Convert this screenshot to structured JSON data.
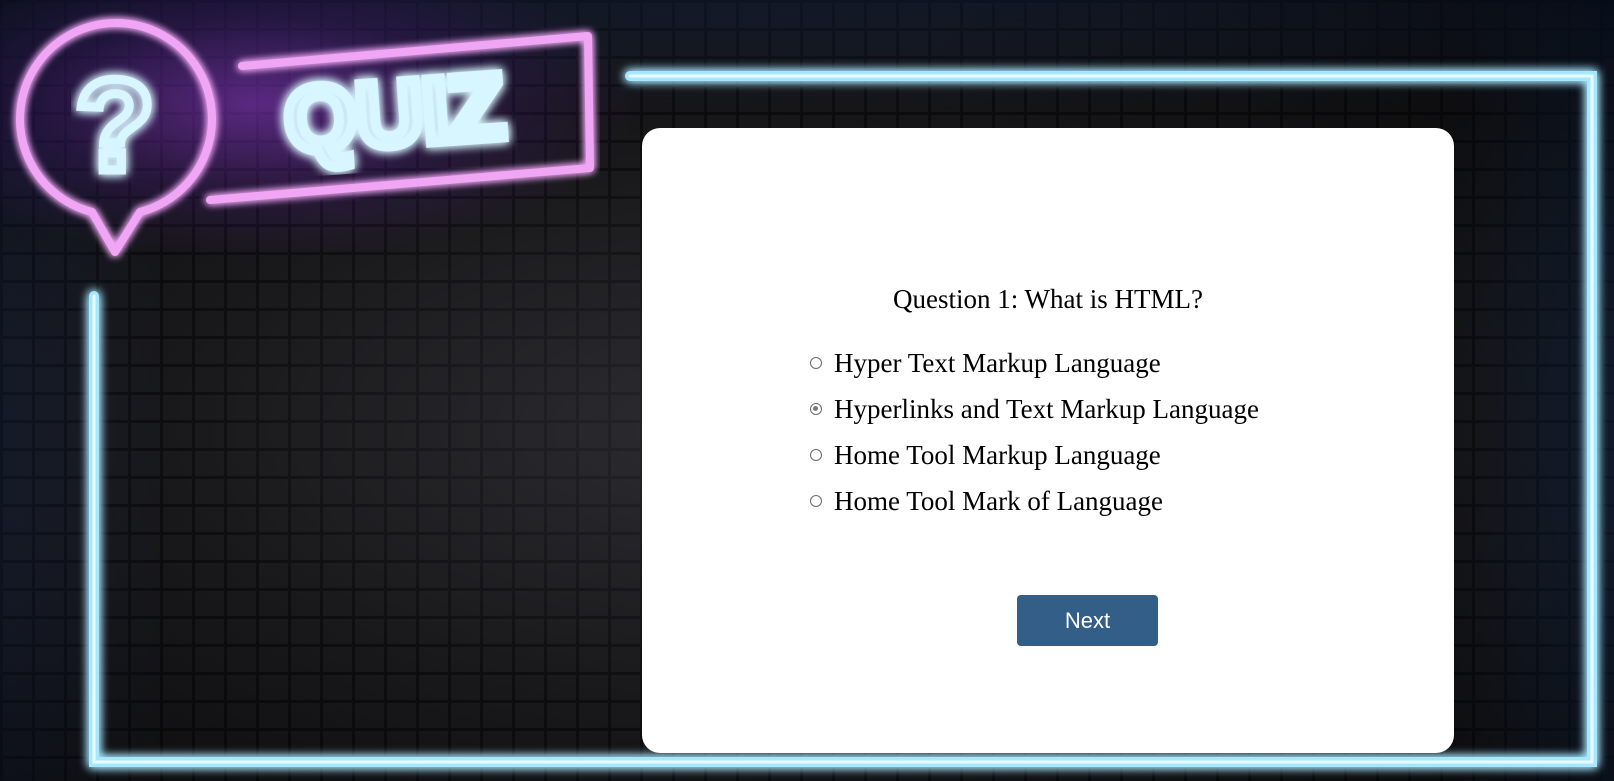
{
  "logo": {
    "question_mark": "?",
    "title": "QUIZ"
  },
  "quiz": {
    "question": "Question 1: What is HTML?",
    "options": [
      {
        "label": "Hyper Text Markup Language",
        "checked": false
      },
      {
        "label": "Hyperlinks and Text Markup Language",
        "checked": true
      },
      {
        "label": "Home Tool Markup Language",
        "checked": false
      },
      {
        "label": "Home Tool Mark of Language",
        "checked": false
      }
    ],
    "next_label": "Next"
  },
  "colors": {
    "neon_cyan": "#a8e8ff",
    "neon_pink": "#f0a6f5",
    "button": "#335e87"
  }
}
